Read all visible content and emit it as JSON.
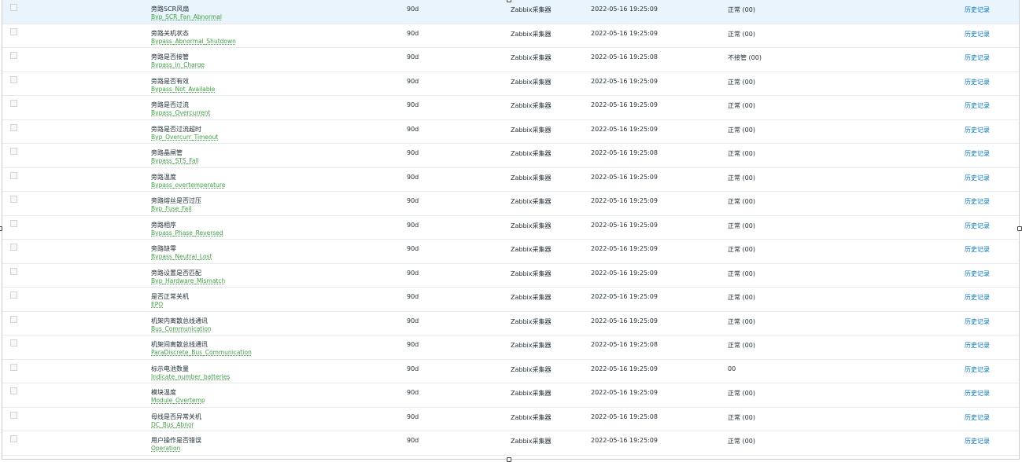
{
  "table": {
    "link_label": "历史记录",
    "selected_row": 0,
    "rows": [
      {
        "name": "旁路SCR风扇",
        "key": "Byp_SCR_Fan_Abnormal",
        "interval": "90d",
        "type": "Zabbix采集器",
        "time": "2022-05-16 19:25:09",
        "value": "正常 (00)"
      },
      {
        "name": "旁路关机状态",
        "key": "Bypass_Abnormal_Shutdown",
        "interval": "90d",
        "type": "Zabbix采集器",
        "time": "2022-05-16 19:25:09",
        "value": "正常 (00)"
      },
      {
        "name": "旁路是否接管",
        "key": "Bypass_in_Charge",
        "interval": "90d",
        "type": "Zabbix采集器",
        "time": "2022-05-16 19:25:08",
        "value": "不接管 (00)"
      },
      {
        "name": "旁路是否有效",
        "key": "Bypass_Not_Available",
        "interval": "90d",
        "type": "Zabbix采集器",
        "time": "2022-05-16 19:25:09",
        "value": "正常 (00)"
      },
      {
        "name": "旁路是否过流",
        "key": "Bypass_Overcurrent",
        "interval": "90d",
        "type": "Zabbix采集器",
        "time": "2022-05-16 19:25:09",
        "value": "正常 (00)"
      },
      {
        "name": "旁路是否过流超时",
        "key": "Byp_Overcurr_Timeout",
        "interval": "90d",
        "type": "Zabbix采集器",
        "time": "2022-05-16 19:25:09",
        "value": "正常 (00)"
      },
      {
        "name": "旁路晶闸管",
        "key": "Bypass_STS_Fail",
        "interval": "90d",
        "type": "Zabbix采集器",
        "time": "2022-05-16 19:25:08",
        "value": "正常 (00)"
      },
      {
        "name": "旁路温度",
        "key": "Bypass_overtemperature",
        "interval": "90d",
        "type": "Zabbix采集器",
        "time": "2022-05-16 19:25:09",
        "value": "正常 (00)"
      },
      {
        "name": "旁路熔丝是否过压",
        "key": "Byp_Fuse_Fail",
        "interval": "90d",
        "type": "Zabbix采集器",
        "time": "2022-05-16 19:25:09",
        "value": "正常 (00)"
      },
      {
        "name": "旁路相序",
        "key": "Bypass_Phase_Reversed",
        "interval": "90d",
        "type": "Zabbix采集器",
        "time": "2022-05-16 19:25:09",
        "value": "正常 (00)"
      },
      {
        "name": "旁路缺零",
        "key": "Bypass_Neutral_Lost",
        "interval": "90d",
        "type": "Zabbix采集器",
        "time": "2022-05-16 19:25:09",
        "value": "正常 (00)"
      },
      {
        "name": "旁路设置是否匹配",
        "key": "Byp_Hardware_Mismatch",
        "interval": "90d",
        "type": "Zabbix采集器",
        "time": "2022-05-16 19:25:09",
        "value": "正常 (00)"
      },
      {
        "name": "是否正常关机",
        "key": "EPO",
        "interval": "90d",
        "type": "Zabbix采集器",
        "time": "2022-05-16 19:25:09",
        "value": "正常 (00)"
      },
      {
        "name": "机架内离散总线通讯",
        "key": "Bus_Communication",
        "interval": "90d",
        "type": "Zabbix采集器",
        "time": "2022-05-16 19:25:09",
        "value": "正常 (00)"
      },
      {
        "name": "机架间离散总线通讯",
        "key": "ParaDiscrete_Bus_Communication",
        "interval": "90d",
        "type": "Zabbix采集器",
        "time": "2022-05-16 19:25:08",
        "value": "正常 (00)"
      },
      {
        "name": "标示电池数量",
        "key": "Indicate_number_batteries",
        "interval": "90d",
        "type": "Zabbix采集器",
        "time": "2022-05-16 19:25:09",
        "value": "00"
      },
      {
        "name": "模块温度",
        "key": "Module_Overtemp",
        "interval": "90d",
        "type": "Zabbix采集器",
        "time": "2022-05-16 19:25:09",
        "value": "正常 (00)"
      },
      {
        "name": "母线是否异常关机",
        "key": "DC_Bus_Abnor",
        "interval": "90d",
        "type": "Zabbix采集器",
        "time": "2022-05-16 19:25:08",
        "value": "正常 (00)"
      },
      {
        "name": "用户操作是否错误",
        "key": "Operation",
        "interval": "90d",
        "type": "Zabbix采集器",
        "time": "2022-05-16 19:25:09",
        "value": "正常 (00)"
      }
    ]
  }
}
